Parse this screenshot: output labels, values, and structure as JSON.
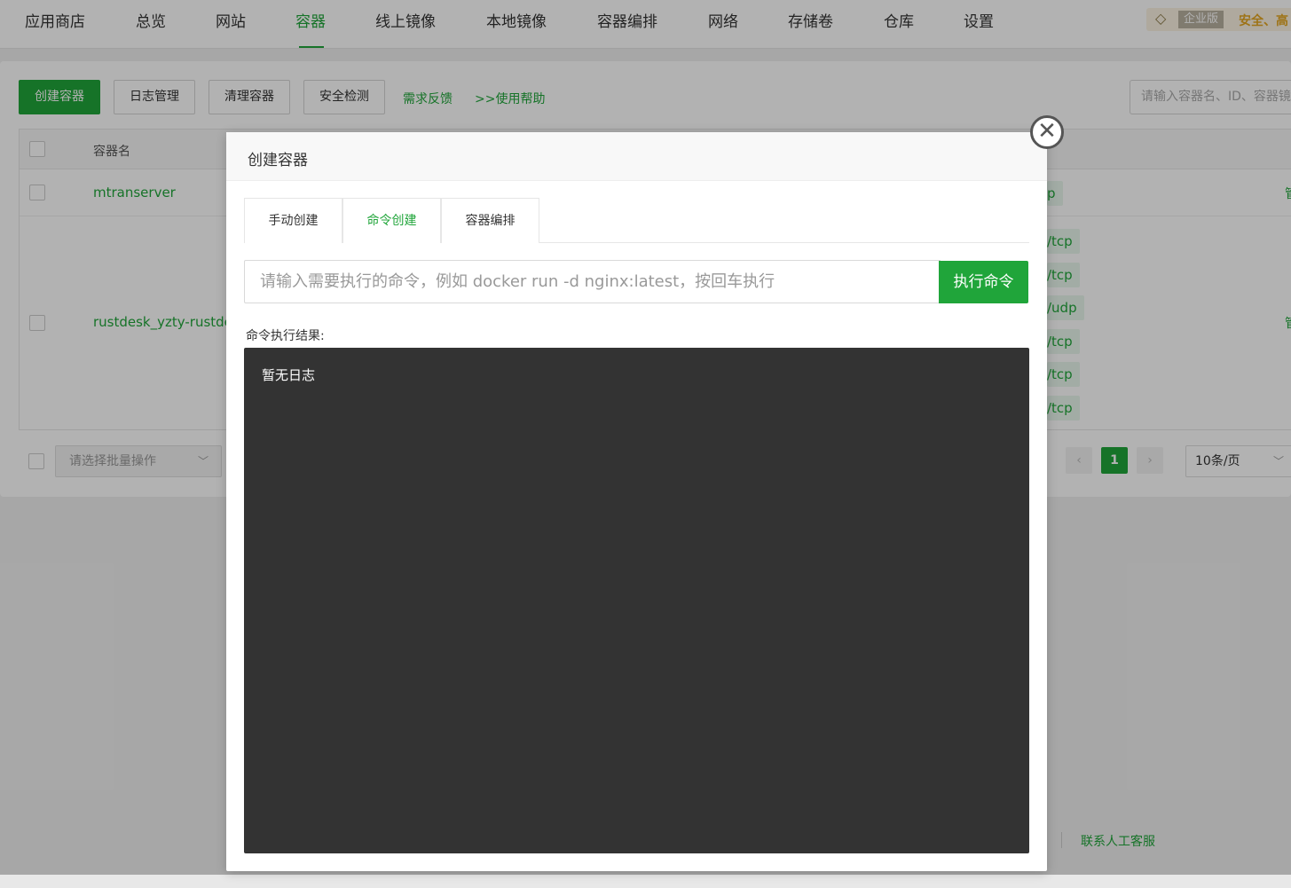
{
  "topnav": {
    "tabs": [
      "应用商店",
      "总览",
      "网站",
      "容器",
      "线上镜像",
      "本地镜像",
      "容器编排",
      "网络",
      "存储卷",
      "仓库",
      "设置"
    ],
    "active_tab": "容器",
    "enterprise_label": "企业版",
    "enterprise_slogan": "安全、高"
  },
  "toolbar": {
    "create_label": "创建容器",
    "log_label": "日志管理",
    "clean_label": "清理容器",
    "security_label": "安全检测",
    "feedback_label": "需求反馈",
    "help_label": ">>使用帮助",
    "search_placeholder": "请输入容器名、ID、容器镜像"
  },
  "table": {
    "header_name": "容器名",
    "rows": [
      {
        "name": "mtranserver",
        "ports": [
          "p"
        ],
        "action": "管"
      },
      {
        "name": "rustdesk_yzty-rustdesk",
        "ports": [
          "/tcp",
          "/tcp",
          "/udp",
          "/tcp",
          "/tcp",
          "/tcp"
        ],
        "action": "管"
      }
    ]
  },
  "footer": {
    "batch_placeholder": "请选择批量操作",
    "current_page": "1",
    "per_page": "10条/页",
    "contact_label": "联系人工客服"
  },
  "modal": {
    "title": "创建容器",
    "tabs": [
      "手动创建",
      "命令创建",
      "容器编排"
    ],
    "active_tab": "命令创建",
    "command_placeholder": "请输入需要执行的命令，例如 docker run -d nginx:latest，按回车执行",
    "run_label": "执行命令",
    "result_label": "命令执行结果:",
    "result_text": "暂无日志"
  },
  "colors": {
    "accent": "#20a53a",
    "console_bg": "#333333"
  },
  "icons": {
    "close": "close-circle-icon",
    "enterprise": "diamond-icon"
  }
}
